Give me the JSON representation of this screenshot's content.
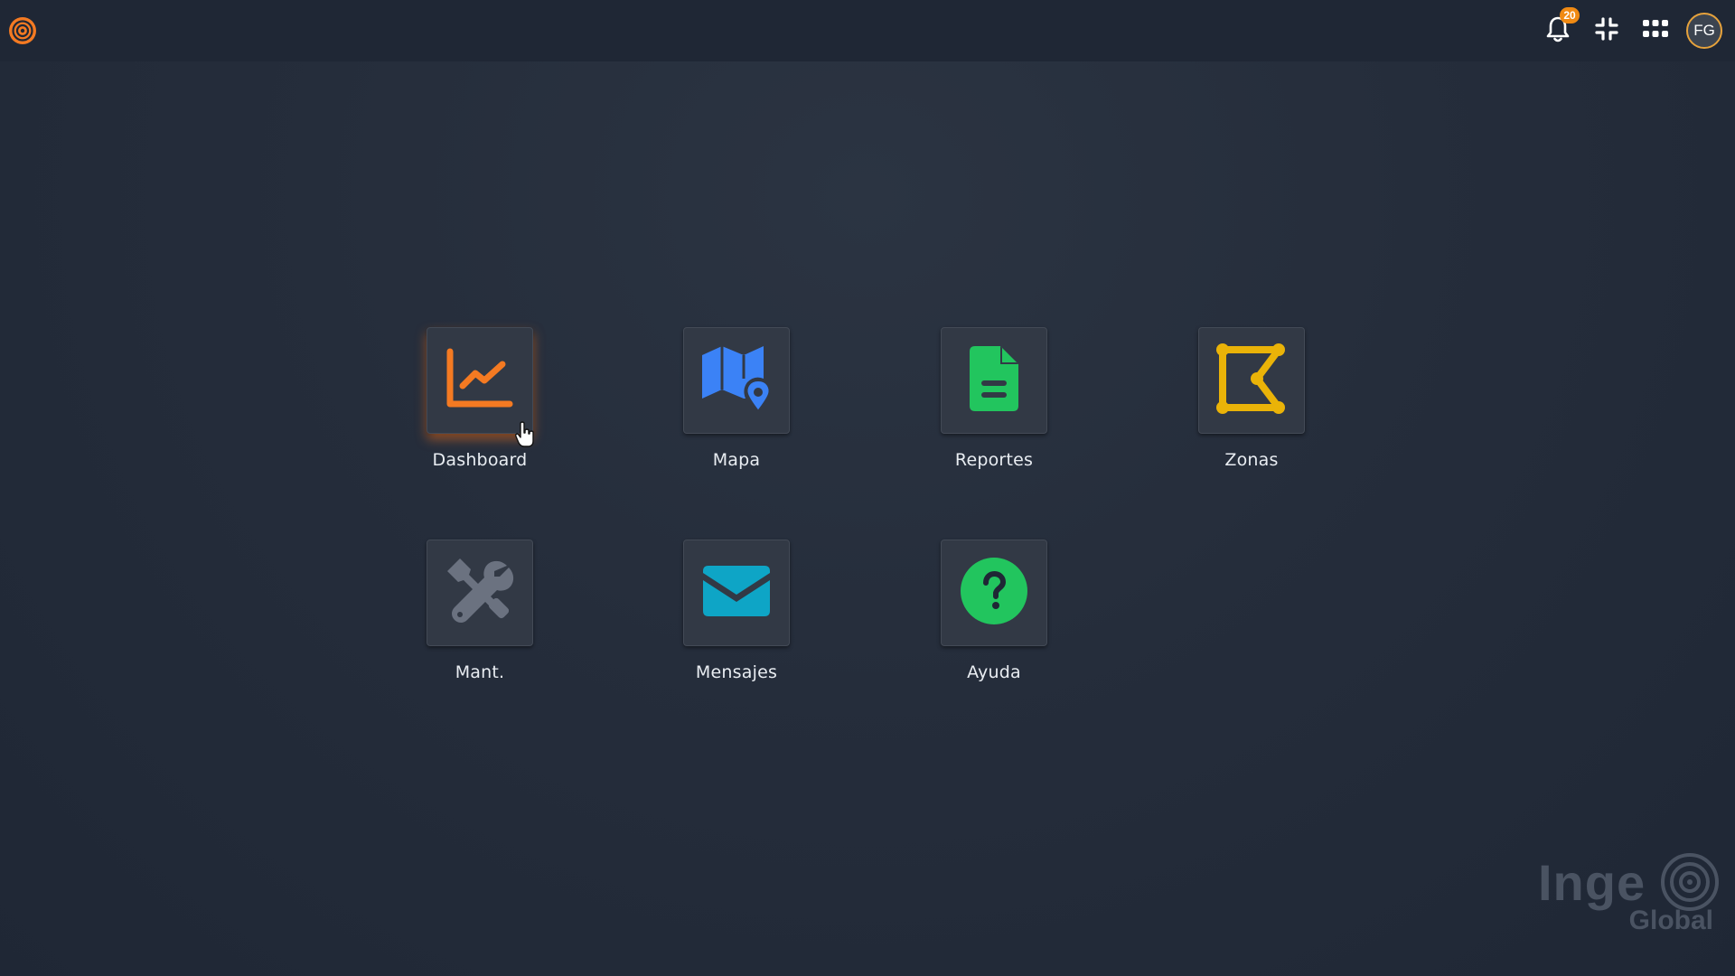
{
  "topbar": {
    "logo_icon": "target-logo-icon",
    "notifications": {
      "icon": "bell-icon",
      "count": "20"
    },
    "compress_icon": "compress-icon",
    "apps_icon": "grid-icon",
    "avatar_initials": "FG"
  },
  "apps": [
    {
      "label": "Dashboard",
      "icon": "line-chart-icon",
      "color": "#f47a22"
    },
    {
      "label": "Mapa",
      "icon": "map-pin-icon",
      "color": "#3b82f6"
    },
    {
      "label": "Reportes",
      "icon": "document-icon",
      "color": "#22c55e"
    },
    {
      "label": "Zonas",
      "icon": "polygon-icon",
      "color": "#eab308"
    },
    {
      "label": "Mant.",
      "icon": "tools-icon",
      "color": "#6b7280"
    },
    {
      "label": "Mensajes",
      "icon": "envelope-icon",
      "color": "#0ea5c6"
    },
    {
      "label": "Ayuda",
      "icon": "help-icon",
      "color": "#22c55e"
    }
  ],
  "watermark": {
    "line1": "Inge",
    "line2": "Global"
  },
  "colors": {
    "accent": "#f08a13",
    "background": "#252d3b",
    "topbar": "#1f2735"
  }
}
